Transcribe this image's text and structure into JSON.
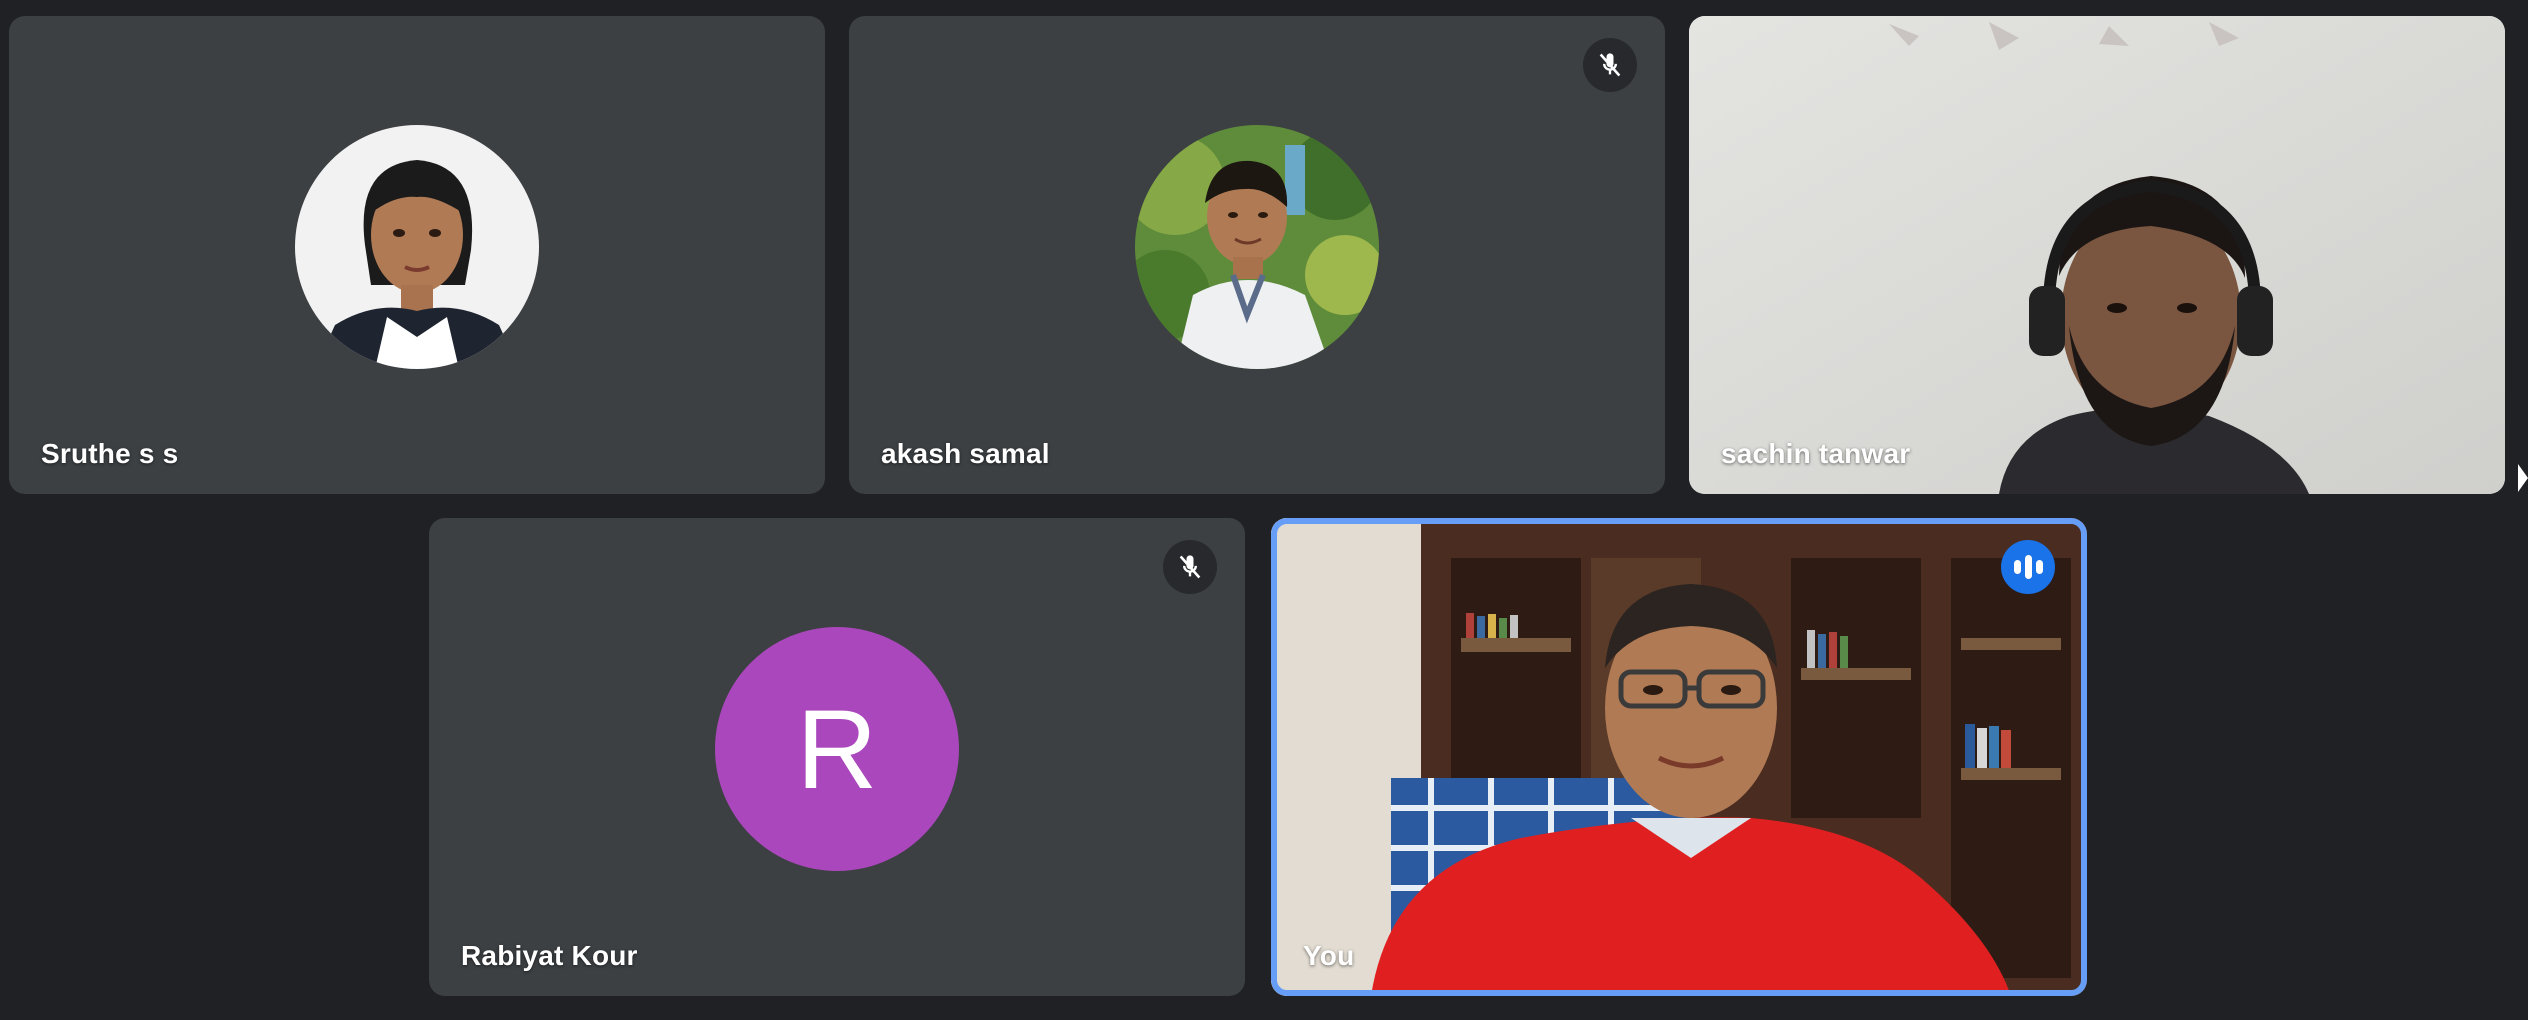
{
  "participants": [
    {
      "name": "Sruthe s s"
    },
    {
      "name": "akash samal"
    },
    {
      "name": "sachin tanwar"
    },
    {
      "name": "Rabiyat Kour",
      "initial": "R"
    },
    {
      "name": "You"
    }
  ],
  "icons": {
    "muted": "mic-off-icon",
    "speaking": "audio-level-icon"
  },
  "colors": {
    "background": "#202124",
    "tile": "#3c4043",
    "active_border": "#669df6",
    "speaking_badge": "#1a73e8",
    "initial_avatar": "#ab47bc"
  }
}
